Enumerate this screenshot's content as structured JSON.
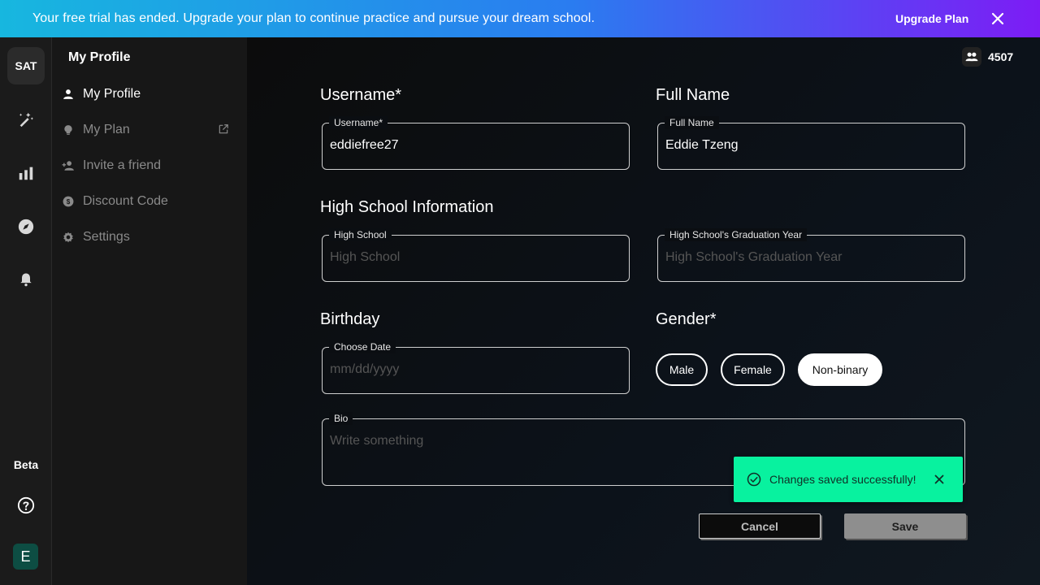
{
  "banner": {
    "message": "Your free trial has ended. Upgrade your plan to continue practice and pursue your dream school.",
    "upgrade_label": "Upgrade Plan",
    "close_icon": "close-icon"
  },
  "rail": {
    "app_badge": "SAT",
    "icons": [
      "practice-icon",
      "stats-icon",
      "compass-icon",
      "bell-icon"
    ],
    "beta_label": "Beta",
    "help_icon": "help-icon",
    "avatar_initial": "E",
    "avatar_color": "#0d4d43"
  },
  "sidemenu": {
    "title": "My Profile",
    "items": [
      {
        "label": "My Profile",
        "icon": "person-icon",
        "active": true
      },
      {
        "label": "My Plan",
        "icon": "lightbulb-icon",
        "external": true
      },
      {
        "label": "Invite a friend",
        "icon": "person-add-icon"
      },
      {
        "label": "Discount Code",
        "icon": "dollar-icon"
      },
      {
        "label": "Settings",
        "icon": "gear-icon"
      }
    ]
  },
  "header": {
    "coins_icon": "people-icon",
    "coins_value": "4507"
  },
  "form": {
    "username_heading": "Username*",
    "username_label": "Username*",
    "username_value": "eddiefree27",
    "fullname_heading": "Full Name",
    "fullname_label": "Full Name",
    "fullname_value": "Eddie Tzeng",
    "highschool_heading": "High School Information",
    "highschool_label": "High School",
    "highschool_placeholder": "High School",
    "gradyear_label": "High School's Graduation Year",
    "gradyear_placeholder": "High School's Graduation Year",
    "birthday_heading": "Birthday",
    "birthday_label": "Choose Date",
    "birthday_placeholder": "mm/dd/yyyy",
    "gender_heading": "Gender*",
    "gender_options": [
      "Male",
      "Female",
      "Non-binary"
    ],
    "gender_selected": "Non-binary",
    "bio_label": "Bio",
    "bio_placeholder": "Write something",
    "cancel_label": "Cancel",
    "save_label": "Save"
  },
  "toast": {
    "message": "Changes saved successfully!",
    "color": "#08f29f",
    "icon": "check-circle-icon"
  }
}
